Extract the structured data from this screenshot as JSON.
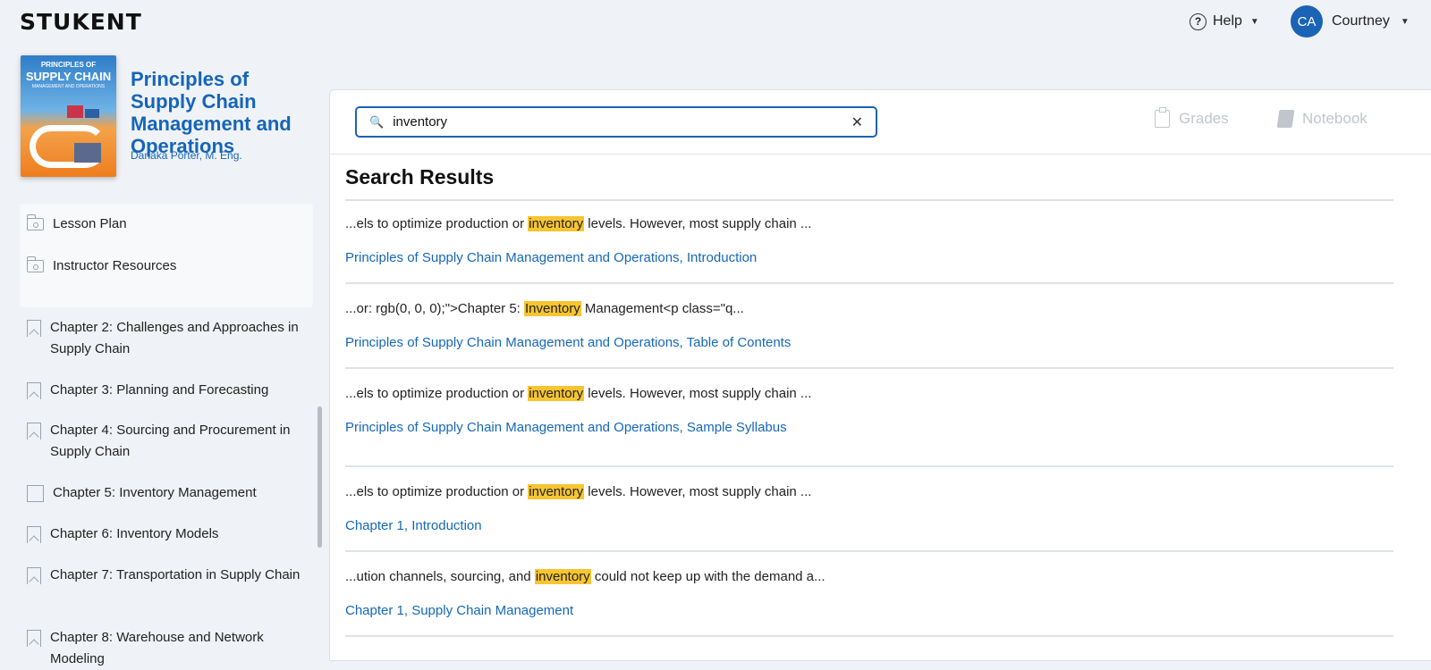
{
  "header": {
    "logo": "STUKENT",
    "help_label": "Help",
    "user_initials": "CA",
    "user_name": "Courtney"
  },
  "book": {
    "cover_line1": "PRINCIPLES OF",
    "cover_line2": "SUPPLY CHAIN",
    "cover_line3": "MANAGEMENT AND OPERATIONS",
    "title": "Principles of Supply Chain Management and Operations",
    "author": "Danaka Porter, M. Eng."
  },
  "sidebar": {
    "resources": [
      {
        "label": "Lesson Plan"
      },
      {
        "label": "Instructor Resources"
      }
    ],
    "chapters": [
      {
        "label": "Chapter 2: Challenges and Approaches in Supply Chain"
      },
      {
        "label": "Chapter 3: Planning and Forecasting"
      },
      {
        "label": "Chapter 4: Sourcing and Procurement in Supply Chain"
      },
      {
        "label": "Chapter 5: Inventory Management"
      },
      {
        "label": "Chapter 6: Inventory Models"
      },
      {
        "label": "Chapter 7: Transportation in Supply Chain"
      },
      {
        "label": "Chapter 8: Warehouse and Network Modeling"
      }
    ]
  },
  "search": {
    "value": "inventory",
    "placeholder": "Search"
  },
  "toolbar": {
    "grades_label": "Grades",
    "notebook_label": "Notebook"
  },
  "results_title": "Search Results",
  "results": [
    {
      "pre": "...els to optimize production or ",
      "match": "inventory",
      "post": " levels. However, most supply chain ...",
      "link": "Principles of Supply Chain Management and Operations, Introduction"
    },
    {
      "pre": "...or: rgb(0, 0, 0);\">Chapter 5: ",
      "match": "Inventory",
      "post": " Management<p class=\"q...",
      "link": "Principles of Supply Chain Management and Operations, Table of Contents"
    },
    {
      "pre": "...els to optimize production or ",
      "match": "inventory",
      "post": " levels. However, most supply chain ...",
      "link": "Principles of Supply Chain Management and Operations, Sample Syllabus"
    },
    {
      "pre": "...els to optimize production or ",
      "match": "inventory",
      "post": " levels. However, most supply chain ...",
      "link": "Chapter 1, Introduction"
    },
    {
      "pre": "...ution channels, sourcing, and ",
      "match": "inventory",
      "post": " could not keep up with the demand a...",
      "link": "Chapter 1, Supply Chain Management"
    }
  ]
}
